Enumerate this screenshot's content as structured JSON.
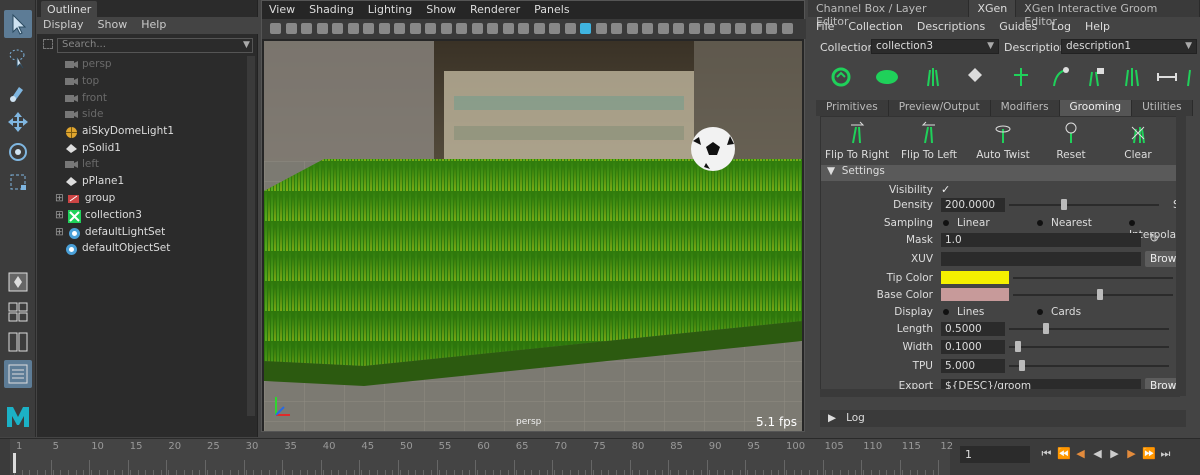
{
  "outliner": {
    "tab": "Outliner",
    "menu": [
      "Display",
      "Show",
      "Help"
    ],
    "search_placeholder": "Search...",
    "items": [
      {
        "label": "persp",
        "icon": "camera-icon",
        "dim": true
      },
      {
        "label": "top",
        "icon": "camera-icon",
        "dim": true
      },
      {
        "label": "front",
        "icon": "camera-icon",
        "dim": true
      },
      {
        "label": "side",
        "icon": "camera-icon",
        "dim": true
      },
      {
        "label": "aiSkyDomeLight1",
        "icon": "globe-icon",
        "dim": false
      },
      {
        "label": "pSolid1",
        "icon": "mesh-icon",
        "dim": false
      },
      {
        "label": "left",
        "icon": "camera-icon",
        "dim": true
      },
      {
        "label": "pPlane1",
        "icon": "mesh-icon",
        "dim": false
      },
      {
        "label": "group",
        "icon": "group-icon",
        "dim": false
      },
      {
        "label": "collection3",
        "icon": "xgen-icon",
        "dim": false
      },
      {
        "label": "defaultLightSet",
        "icon": "set-icon",
        "dim": false
      },
      {
        "label": "defaultObjectSet",
        "icon": "set-icon",
        "dim": false
      }
    ]
  },
  "viewport": {
    "menu": [
      "View",
      "Shading",
      "Lighting",
      "Show",
      "Renderer",
      "Panels"
    ],
    "camera_label": "persp",
    "fps": "5.1 fps"
  },
  "right_panel": {
    "tabs": [
      "Channel Box / Layer Editor",
      "XGen",
      "XGen Interactive Groom Editor"
    ],
    "menu": [
      "File",
      "Collection",
      "Descriptions",
      "Guides",
      "Log",
      "Help"
    ],
    "collection_label": "Collection",
    "collection_value": "collection3",
    "description_label": "Description",
    "description_value": "description1",
    "sub_tabs": [
      "Primitives",
      "Preview/Output",
      "Modifiers",
      "Grooming",
      "Utilities"
    ],
    "groom_buttons": [
      "Flip To Right",
      "Flip To Left",
      "Auto Twist",
      "Reset",
      "Clear"
    ],
    "settings_header": "Settings",
    "params": {
      "visibility": "Visibility",
      "density": "Density",
      "density_value": "200.0000",
      "sampling": "Sampling",
      "sampling_options": [
        "Linear",
        "Nearest",
        "Interpola"
      ],
      "mask": "Mask",
      "mask_value": "1.0",
      "xuv": "XUV",
      "browse": "Browse",
      "tip_color": "Tip Color",
      "base_color": "Base Color",
      "display": "Display",
      "display_options": [
        "Lines",
        "Cards"
      ],
      "length": "Length",
      "length_value": "0.5000",
      "width": "Width",
      "width_value": "0.1000",
      "tpu": "TPU",
      "tpu_value": "5.000",
      "export": "Export",
      "export_value": "${DESC}/groom",
      "density_trailing": "S"
    },
    "log": "Log",
    "colors": {
      "tip": "#f5f000",
      "base": "#c79a9a"
    }
  },
  "timeline": {
    "ticks": [
      "1",
      "5",
      "10",
      "15",
      "20",
      "25",
      "30",
      "35",
      "40",
      "45",
      "50",
      "55",
      "60",
      "65",
      "70",
      "75",
      "80",
      "85",
      "90",
      "95",
      "100",
      "105",
      "110",
      "115",
      "12"
    ],
    "current_frame": "1"
  }
}
